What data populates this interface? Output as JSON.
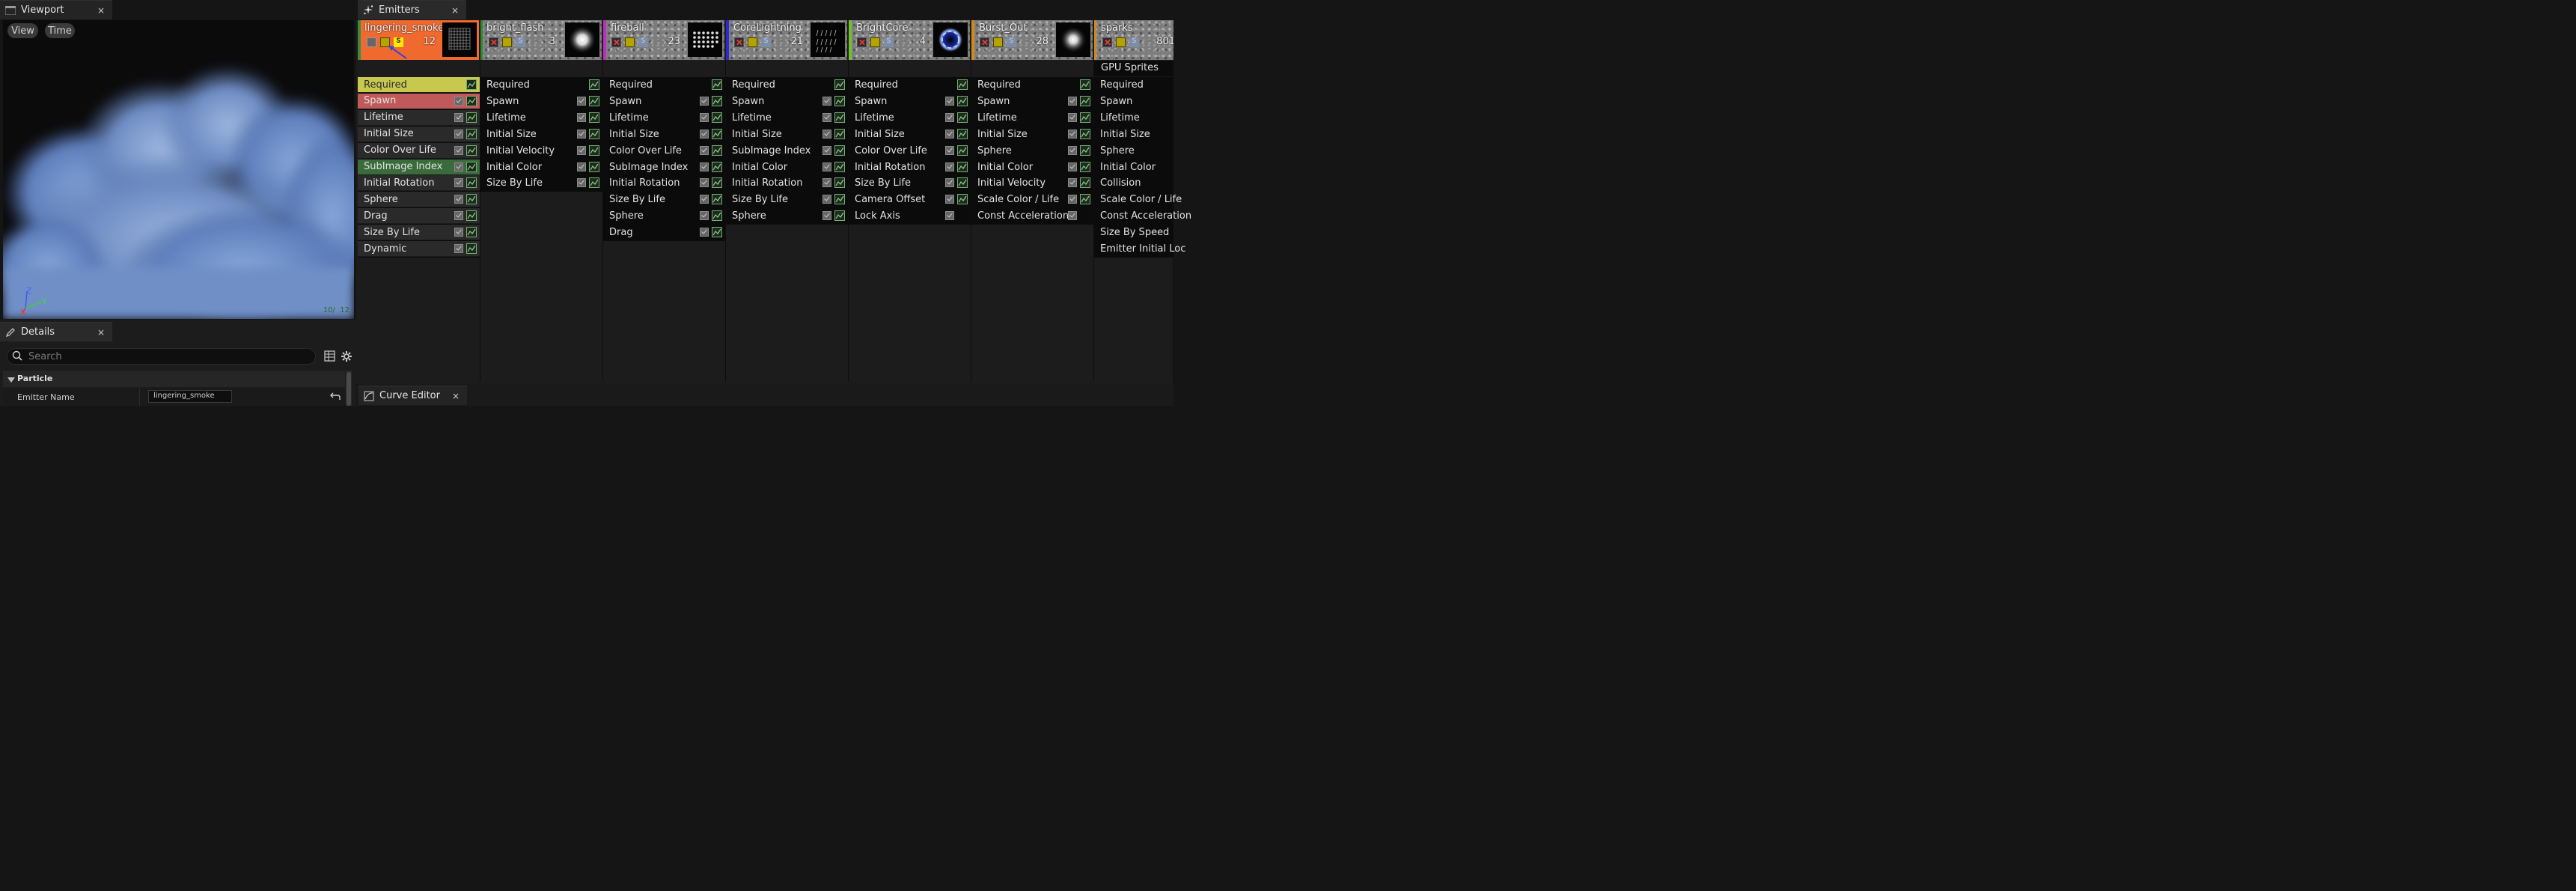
{
  "viewport_panel": {
    "title": "Viewport",
    "close": "×",
    "buttons": [
      "View",
      "Time"
    ],
    "axis_labels": {
      "z": "Z",
      "y": "Y",
      "x": "X"
    },
    "frame_counter": "10/  12"
  },
  "details_panel": {
    "title": "Details",
    "close": "×",
    "search_placeholder": "Search",
    "section_label": "Particle",
    "property_label": "Emitter Name",
    "property_value": "lingering_smoke"
  },
  "emitters_panel": {
    "title": "Emitters",
    "close": "×"
  },
  "curve_editor_panel": {
    "title": "Curve Editor",
    "close": "×"
  },
  "colors": {
    "selected_emitter": "#f06a30",
    "required_module": "#c9c84e",
    "spawn_module": "#c05a5a",
    "subimage_module": "#3a6b3a"
  },
  "emitters": [
    {
      "name": "lingering_smoke",
      "count": "12",
      "stripe": "#3c8a3c",
      "solo_label": "S",
      "thumbnail": "grid-sprite-icon",
      "modules": [
        "Required",
        "Spawn",
        "Lifetime",
        "Initial Size",
        "Color Over Life",
        "SubImage Index",
        "Initial Rotation",
        "Sphere",
        "Drag",
        "Size By Life",
        "Dynamic"
      ]
    },
    {
      "name": "bright_flash",
      "count": "3",
      "stripe": "#2a8a2a",
      "solo_label": "S",
      "thumbnail": "soft-glow-icon",
      "modules": [
        "Required",
        "Spawn",
        "Lifetime",
        "Initial Size",
        "Initial Velocity",
        "Initial Color",
        "Size By Life"
      ]
    },
    {
      "name": "fireball",
      "count": "23",
      "stripe": "#c02cc0",
      "solo_label": "S",
      "thumbnail": "dot-grid-icon",
      "modules": [
        "Required",
        "Spawn",
        "Lifetime",
        "Initial Size",
        "Color Over Life",
        "SubImage Index",
        "Initial Rotation",
        "Size By Life",
        "Sphere",
        "Drag"
      ]
    },
    {
      "name": "CoreLightning",
      "count": "21",
      "stripe": "#2b2bd0",
      "solo_label": "S",
      "thumbnail": "lightning-strands-icon",
      "modules": [
        "Required",
        "Spawn",
        "Lifetime",
        "Initial Size",
        "SubImage Index",
        "Initial Color",
        "Initial Rotation",
        "Size By Life",
        "Sphere"
      ]
    },
    {
      "name": "BrightCore",
      "count": "4",
      "stripe": "#6fc22a",
      "solo_label": "S",
      "thumbnail": "blue-ring-icon",
      "modules": [
        "Required",
        "Spawn",
        "Lifetime",
        "Initial Size",
        "Color Over Life",
        "Initial Rotation",
        "Size By Life",
        "Camera Offset",
        "Lock Axis"
      ]
    },
    {
      "name": "Burst_Out",
      "count": "28",
      "stripe": "#d08a1a",
      "solo_label": "S",
      "thumbnail": "soft-glow-icon",
      "modules": [
        "Required",
        "Spawn",
        "Lifetime",
        "Initial Size",
        "Sphere",
        "Initial Color",
        "Initial Velocity",
        "Scale Color / Life",
        "Const Acceleration"
      ]
    },
    {
      "name": "sparks",
      "count": "801",
      "stripe": "#d08a1a",
      "solo_label": "S",
      "thumbnail": "none",
      "type_label": "GPU Sprites",
      "modules": [
        "Required",
        "Spawn",
        "Lifetime",
        "Initial Size",
        "Sphere",
        "Initial Color",
        "Collision",
        "Scale Color / Life",
        "Const Acceleration",
        "Size By Speed",
        "Emitter Initial Loc"
      ]
    }
  ]
}
